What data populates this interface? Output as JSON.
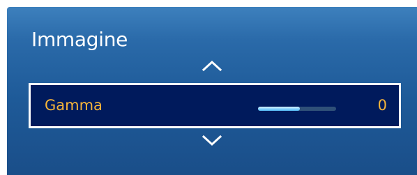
{
  "menu": {
    "title": "Immagine",
    "up_arrow_icon": "chevron-up-icon",
    "down_arrow_icon": "chevron-down-icon",
    "selected_item": {
      "label": "Gamma",
      "value": "0",
      "slider_fill_percent": 54
    }
  },
  "colors": {
    "panel_top": "#3d80bd",
    "panel_bottom": "#1a4e89",
    "highlight_bg": "#001a5c",
    "highlight_border": "#ffffff",
    "label_text": "#f6b53a",
    "slider_track": "#2f5078",
    "slider_fill": "#7fd0ff"
  }
}
